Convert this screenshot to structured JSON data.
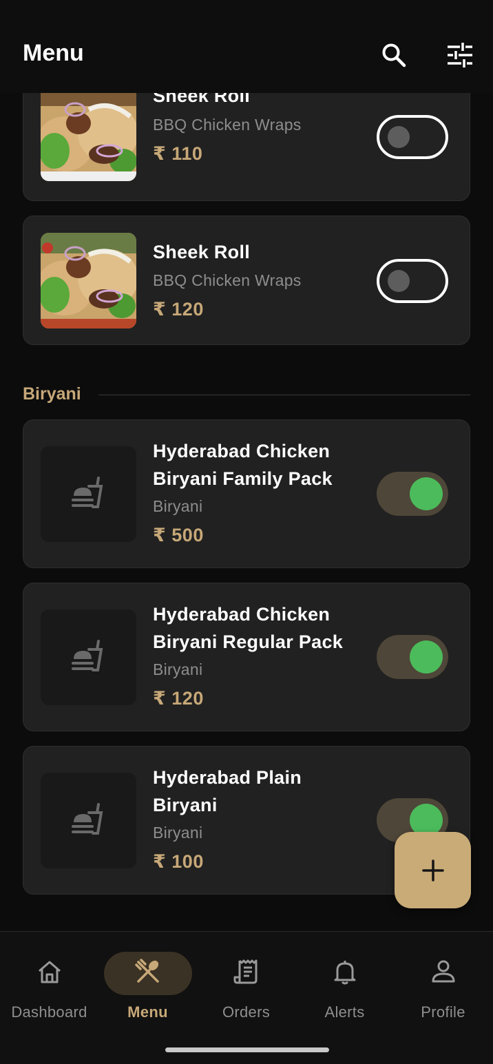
{
  "header": {
    "title": "Menu",
    "icons": [
      "search-icon",
      "filter-sliders-icon"
    ]
  },
  "rolls": [
    {
      "name": "Sheek Roll",
      "subtitle": "BBQ Chicken Wraps",
      "price": "₹ 110",
      "available": false
    },
    {
      "name": "Sheek Roll",
      "subtitle": "BBQ Chicken Wraps",
      "price": "₹ 120",
      "available": false
    }
  ],
  "sections": [
    {
      "title": "Biryani",
      "items": [
        {
          "name": "Hyderabad Chicken Biryani Family Pack",
          "subtitle": "Biryani",
          "price": "₹ 500",
          "available": true
        },
        {
          "name": "Hyderabad Chicken Biryani Regular Pack",
          "subtitle": "Biryani",
          "price": "₹ 120",
          "available": true
        },
        {
          "name": "Hyderabad Plain Biryani",
          "subtitle": "Biryani",
          "price": "₹ 100",
          "available": true
        }
      ]
    }
  ],
  "fab": {
    "icon": "plus-icon"
  },
  "nav": {
    "items": [
      {
        "label": "Dashboard",
        "icon": "home-icon",
        "active": false
      },
      {
        "label": "Menu",
        "icon": "fork-spoon-icon",
        "active": true
      },
      {
        "label": "Orders",
        "icon": "receipt-icon",
        "active": false
      },
      {
        "label": "Alerts",
        "icon": "bell-icon",
        "active": false
      },
      {
        "label": "Profile",
        "icon": "person-icon",
        "active": false
      }
    ]
  },
  "colors": {
    "background": "#0c0c0c",
    "card": "#212121",
    "accent": "#c7a878",
    "toggle_on": "#4cbb5b",
    "toggle_track_on": "#4e4638"
  }
}
